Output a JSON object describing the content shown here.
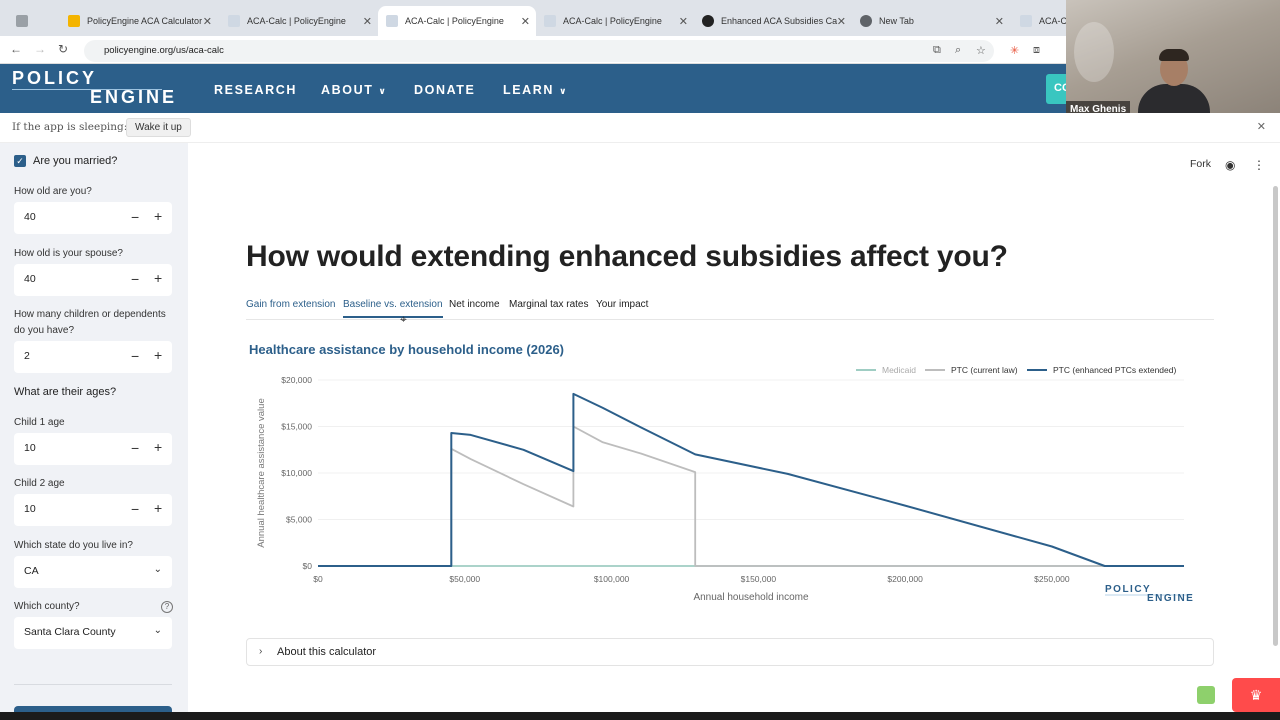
{
  "browser": {
    "tabs": [
      {
        "label": "PolicyEngine ACA Calculator",
        "fav_color": "#f4b400"
      },
      {
        "label": "ACA-Calc | PolicyEngine",
        "fav_color": "#cfd8e3"
      },
      {
        "label": "ACA-Calc | PolicyEngine",
        "fav_color": "#cfd8e3"
      },
      {
        "label": "ACA-Calc | PolicyEngine",
        "fav_color": "#cfd8e3"
      },
      {
        "label": "Enhanced ACA Subsidies Ca",
        "fav_color": "#222222"
      },
      {
        "label": "New Tab",
        "fav_color": "#5f6368"
      },
      {
        "label": "ACA-Ca",
        "fav_color": "#cfd8e3"
      }
    ],
    "url": "policyengine.org/us/aca-calc"
  },
  "header": {
    "logo_line1": "POLICY",
    "logo_line2": "ENGINE",
    "nav": [
      "RESEARCH",
      "ABOUT",
      "DONATE",
      "LEARN"
    ],
    "cta": "CO"
  },
  "webcam": {
    "name": "Max Ghenis"
  },
  "sleep": {
    "text": "If the app is sleeping:",
    "button": "Wake it up"
  },
  "sidebar": {
    "married_label": "Are you married?",
    "age_label": "How old are you?",
    "age_value": "40",
    "spouse_label": "How old is your spouse?",
    "spouse_value": "40",
    "children_label": "How many children or dependents do you have?",
    "children_value": "2",
    "ages_header": "What are their ages?",
    "child1_label": "Child 1 age",
    "child1_value": "10",
    "child2_label": "Child 2 age",
    "child2_value": "10",
    "state_label": "Which state do you live in?",
    "state_value": "CA",
    "county_label": "Which county?",
    "county_value": "Santa Clara County",
    "minus": "−",
    "plus": "+",
    "chevron": "⌄",
    "help": "?"
  },
  "main": {
    "fork": "Fork",
    "title": "How would extending enhanced subsidies affect you?",
    "tabs": [
      "Gain from extension",
      "Baseline vs. extension",
      "Net income",
      "Marginal tax rates",
      "Your impact"
    ],
    "active_tab": "Baseline vs. extension",
    "chart_title": "Healthcare assistance by household income (2026)",
    "about": "About this calculator"
  },
  "chart_data": {
    "type": "line",
    "title": "Healthcare assistance by household income (2026)",
    "xlabel": "Annual household income",
    "ylabel": "Annual healthcare assistance value",
    "xlim": [
      0,
      295000
    ],
    "ylim": [
      0,
      20000
    ],
    "x_ticks": [
      "$0",
      "$50,000",
      "$100,000",
      "$150,000",
      "$200,000",
      "$250,000"
    ],
    "y_ticks": [
      "$0",
      "$5,000",
      "$10,000",
      "$15,000",
      "$20,000"
    ],
    "legend_position": "top-right",
    "watermark_line1": "POLICY",
    "watermark_line2": "ENGINE",
    "series": [
      {
        "name": "Medicaid",
        "color": "#9fcdc3",
        "points": [
          [
            0,
            0
          ],
          [
            295000,
            0
          ]
        ]
      },
      {
        "name": "PTC (current law)",
        "color": "#bdbdbd",
        "points": [
          [
            0,
            0
          ],
          [
            45400,
            0
          ],
          [
            45400,
            12600
          ],
          [
            52000,
            11500
          ],
          [
            70000,
            8800
          ],
          [
            87000,
            6400
          ],
          [
            87000,
            15000
          ],
          [
            97000,
            13300
          ],
          [
            110000,
            12100
          ],
          [
            128500,
            10100
          ],
          [
            128500,
            0
          ],
          [
            295000,
            0
          ]
        ]
      },
      {
        "name": "PTC (enhanced PTCs extended)",
        "color": "#2c5f8a",
        "points": [
          [
            0,
            0
          ],
          [
            45400,
            0
          ],
          [
            45400,
            14300
          ],
          [
            52000,
            14100
          ],
          [
            70000,
            12500
          ],
          [
            87000,
            10200
          ],
          [
            87000,
            18500
          ],
          [
            97000,
            17000
          ],
          [
            110000,
            14900
          ],
          [
            128500,
            12000
          ],
          [
            160000,
            9900
          ],
          [
            200000,
            6500
          ],
          [
            250000,
            2100
          ],
          [
            268000,
            0
          ],
          [
            295000,
            0
          ]
        ]
      }
    ]
  }
}
